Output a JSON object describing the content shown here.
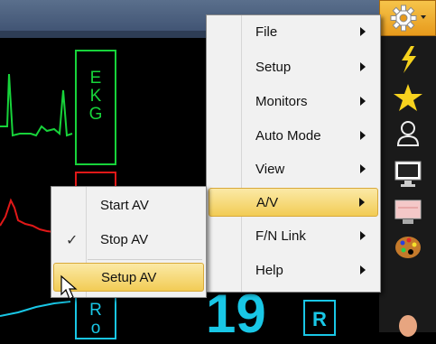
{
  "monitor": {
    "ekg_letters": [
      "E",
      "K",
      "G"
    ],
    "cyan_letters": [
      "R",
      "o"
    ],
    "big_value": "19",
    "r_badge": "R"
  },
  "toolbar": {
    "icons": [
      "gear-icon",
      "lightning-icon",
      "star-icon",
      "person-icon",
      "monitor-icon",
      "display-icon",
      "palette-icon",
      "hand-icon"
    ],
    "selected": "gear-icon",
    "accent": "#f2b631"
  },
  "main_menu": {
    "items": [
      {
        "label": "File",
        "submenu": true
      },
      {
        "label": "Setup",
        "submenu": true
      },
      {
        "label": "Monitors",
        "submenu": true
      },
      {
        "label": "Auto Mode",
        "submenu": true
      },
      {
        "label": "View",
        "submenu": true
      },
      {
        "label": "A/V",
        "submenu": true,
        "highlighted": true
      },
      {
        "label": "F/N Link",
        "submenu": true
      },
      {
        "label": "Help",
        "submenu": true
      }
    ]
  },
  "av_submenu": {
    "items": [
      {
        "label": "Start AV",
        "checked": false
      },
      {
        "label": "Stop AV",
        "checked": true
      },
      {
        "label": "Setup AV",
        "checked": false,
        "highlighted": true
      }
    ]
  },
  "colors": {
    "ekg": "#17d33a",
    "pleth": "#e01818",
    "resp": "#19c7e6",
    "highlight": "#f2cc55"
  }
}
